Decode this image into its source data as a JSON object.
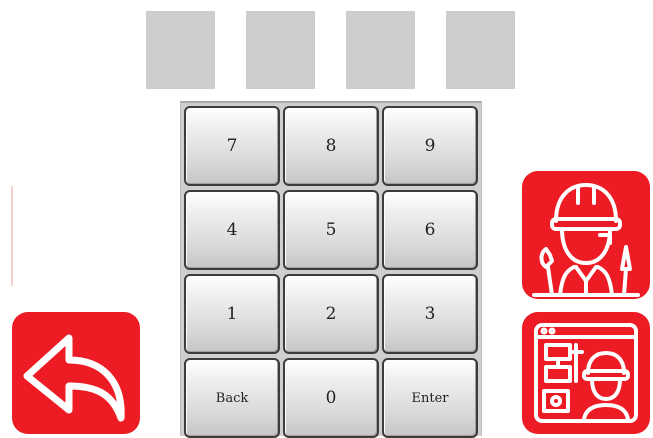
{
  "pin_display": {
    "slot_count": 4,
    "filled": 0
  },
  "keypad": {
    "keys": [
      [
        "7",
        "8",
        "9"
      ],
      [
        "4",
        "5",
        "6"
      ],
      [
        "1",
        "2",
        "3"
      ],
      [
        "Back",
        "0",
        "Enter"
      ]
    ]
  },
  "colors": {
    "accent": "#ed1c24",
    "slot": "#cdcdcd",
    "key_border": "#3c3c3c"
  },
  "icons": {
    "back": "back-arrow-icon",
    "worker": "engineer-worker-icon",
    "technician": "technician-console-icon"
  }
}
